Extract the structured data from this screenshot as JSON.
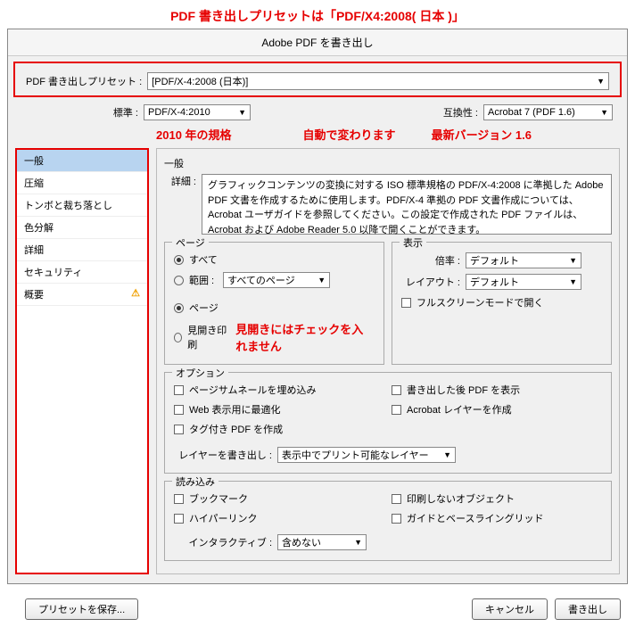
{
  "annotations": {
    "top": "PDF 書き出しプリセットは「PDF/X4:2008( 日本 )」",
    "std": "2010 年の規格",
    "auto": "自動で変わります",
    "ver": "最新バージョン 1.6",
    "spread": "見開きにはチェックを入れません"
  },
  "dialog": {
    "title": "Adobe PDF を書き出し",
    "preset_label": "PDF 書き出しプリセット :",
    "preset_value": "[PDF/X-4:2008 (日本)]",
    "standard_label": "標準 :",
    "standard_value": "PDF/X-4:2010",
    "compat_label": "互換性 :",
    "compat_value": "Acrobat 7 (PDF 1.6)"
  },
  "sidebar": {
    "items": [
      "一般",
      "圧縮",
      "トンボと裁ち落とし",
      "色分解",
      "詳細",
      "セキュリティ",
      "概要"
    ]
  },
  "general": {
    "title": "一般",
    "desc_label": "詳細 :",
    "desc_text": "グラフィックコンテンツの変換に対する ISO 標準規格の PDF/X-4:2008 に準拠した Adobe PDF 文書を作成するために使用します。PDF/X-4 準拠の PDF 文書作成については、Acrobat ユーザガイドを参照してください。この設定で作成された PDF ファイルは、Acrobat および Adobe Reader 5.0 以降で開くことができます。",
    "pages": {
      "legend": "ページ",
      "all": "すべて",
      "range": "範囲 :",
      "range_value": "すべてのページ",
      "page": "ページ",
      "spread": "見開き印刷"
    },
    "display": {
      "legend": "表示",
      "zoom_label": "倍率 :",
      "zoom_value": "デフォルト",
      "layout_label": "レイアウト :",
      "layout_value": "デフォルト",
      "fullscreen": "フルスクリーンモードで開く"
    },
    "options": {
      "legend": "オプション",
      "thumb": "ページサムネールを埋め込み",
      "show_after": "書き出した後 PDF を表示",
      "web_opt": "Web 表示用に最適化",
      "acrobat_layer": "Acrobat レイヤーを作成",
      "tagged": "タグ付き PDF を作成",
      "export_layers_label": "レイヤーを書き出し :",
      "export_layers_value": "表示中でプリント可能なレイヤー"
    },
    "import": {
      "legend": "読み込み",
      "bookmark": "ブックマーク",
      "nonprint": "印刷しないオブジェクト",
      "hyperlink": "ハイパーリンク",
      "guide": "ガイドとベースライングリッド",
      "interactive_label": "インタラクティブ :",
      "interactive_value": "含めない"
    }
  },
  "footer": {
    "save_preset": "プリセットを保存...",
    "cancel": "キャンセル",
    "export": "書き出し"
  }
}
